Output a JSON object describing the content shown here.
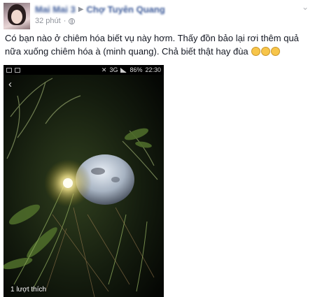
{
  "post": {
    "author_name": "Mai Mai 3",
    "group_name": "Chợ Tuyên Quang",
    "time": "32 phút",
    "text": "Có bạn nào ở chiêm hóa biết vụ này hơm. Thấy đồn bảo lại rơi thêm quả nữa xuống chiêm hóa à (minh quang). Chả biết thật hay đùa",
    "emoji_count": 3
  },
  "photo": {
    "statusbar": {
      "battery": "86%",
      "network": "3G",
      "time": "22:30"
    },
    "likes_text": "1 lượt thích"
  },
  "icons": {
    "back": "back-arrow-icon",
    "privacy": "globe-icon",
    "menu": "chevron-down-icon"
  },
  "colors": {
    "link": "#3b5998",
    "meta": "#90949c"
  }
}
